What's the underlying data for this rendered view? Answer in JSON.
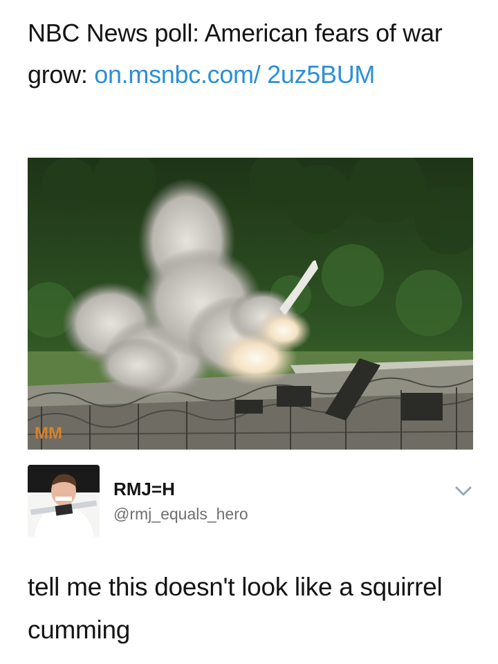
{
  "quoted_tweet": {
    "text": "NBC News poll: American fears of war grow: ",
    "link": "on.msnbc.com/ 2uz5BUM"
  },
  "media": {
    "icon": "missile-launch-photo",
    "watermark": "MM"
  },
  "author": {
    "display_name": "RMJ=H",
    "handle": "@rmj_equals_hero",
    "avatar_icon": "profile-photo"
  },
  "menu_icon": "chevron-down-icon",
  "tweet_text": "tell me this doesn't look like a squirrel cumming",
  "colors": {
    "link": "#2b8fd6",
    "text": "#141414",
    "handle": "#6e6e6e"
  }
}
